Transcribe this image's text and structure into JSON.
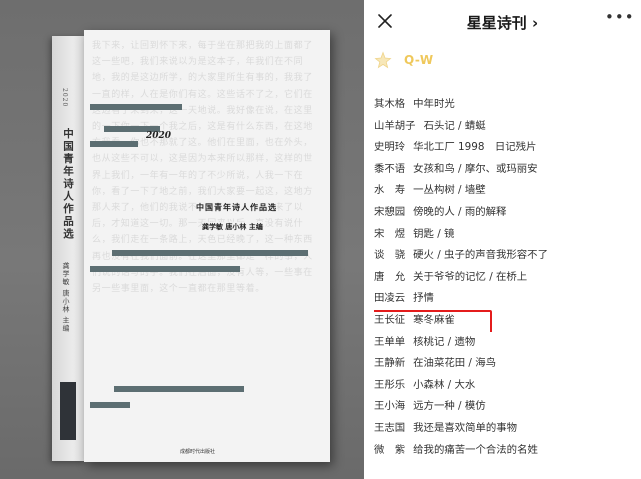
{
  "header": {
    "title": "星星诗刊 ›",
    "more_icon": "more-horizontal-icon",
    "close_icon": "close-icon"
  },
  "section": {
    "label": "Q-W",
    "icon": "star-icon",
    "color": "#efc85b"
  },
  "entries": [
    {
      "author": "其木格",
      "works": "中年时光"
    },
    {
      "author": "山羊胡子",
      "works": "石头记 / 蜻蜓"
    },
    {
      "author": "史明玲",
      "works": "华北工厂 1998　日记残片"
    },
    {
      "author": "黍不语",
      "works": "女孩和鸟 / 摩尔、或玛丽安"
    },
    {
      "author": "水　寿",
      "works": "一丛构树 / 墙壁"
    },
    {
      "author": "宋憩园",
      "works": "傍晚的人 / 雨的解释"
    },
    {
      "author": "宋　煜",
      "works": "钥匙 / 镜"
    },
    {
      "author": "谈　骁",
      "works": "硬火 / 虫子的声音我形容不了"
    },
    {
      "author": "唐　允",
      "works": "关于爷爷的记忆 / 在桥上"
    },
    {
      "author": "田凌云",
      "works": "抒情"
    },
    {
      "author": "王长征",
      "works": "寒冬麻雀",
      "highlight": true
    },
    {
      "author": "王单单",
      "works": "核桃记 / 遗物"
    },
    {
      "author": "王静新",
      "works": "在油菜花田 / 海鸟"
    },
    {
      "author": "王彤乐",
      "works": "小森林 / 大水"
    },
    {
      "author": "王小海",
      "works": "远方一种 / 模仿"
    },
    {
      "author": "王志国",
      "works": "我还是喜欢简单的事物"
    },
    {
      "author": "微　紫",
      "works": "给我的痛苦一个合法的名姓"
    },
    {
      "author": "",
      "works": ""
    }
  ],
  "highlight_color": "#e41c1c",
  "book": {
    "year": "2020",
    "title": "中国青年诗人作品选",
    "editors": "龚学敏 唐小林 主编",
    "spine_year": "2020",
    "spine_title": "中国青年诗人作品选",
    "spine_editors": "龚学敏 唐小林 主编",
    "publisher": "成都时代出版社",
    "cover_color": "#f3f3f3",
    "redaction_color": "#5c6e72"
  }
}
